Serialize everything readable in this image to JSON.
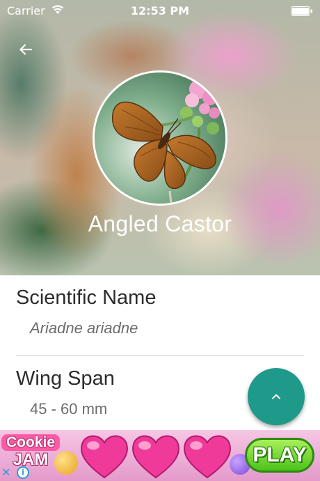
{
  "status_bar": {
    "carrier": "Carrier",
    "time": "12:53 PM"
  },
  "header": {
    "back_icon": "arrow-left-icon",
    "species_name": "Angled Castor"
  },
  "details": {
    "scientific_name": {
      "title": "Scientific Name",
      "value": "Ariadne ariadne"
    },
    "wing_span": {
      "title": "Wing Span",
      "value": "45 - 60 mm"
    }
  },
  "fab": {
    "icon": "chevron-up-icon",
    "color": "#1e998a"
  },
  "ad": {
    "logo_line1": "Cookie",
    "logo_line2": "JAM",
    "play_label": "PLAY",
    "close_icon": "✕",
    "info_icon": "i"
  }
}
